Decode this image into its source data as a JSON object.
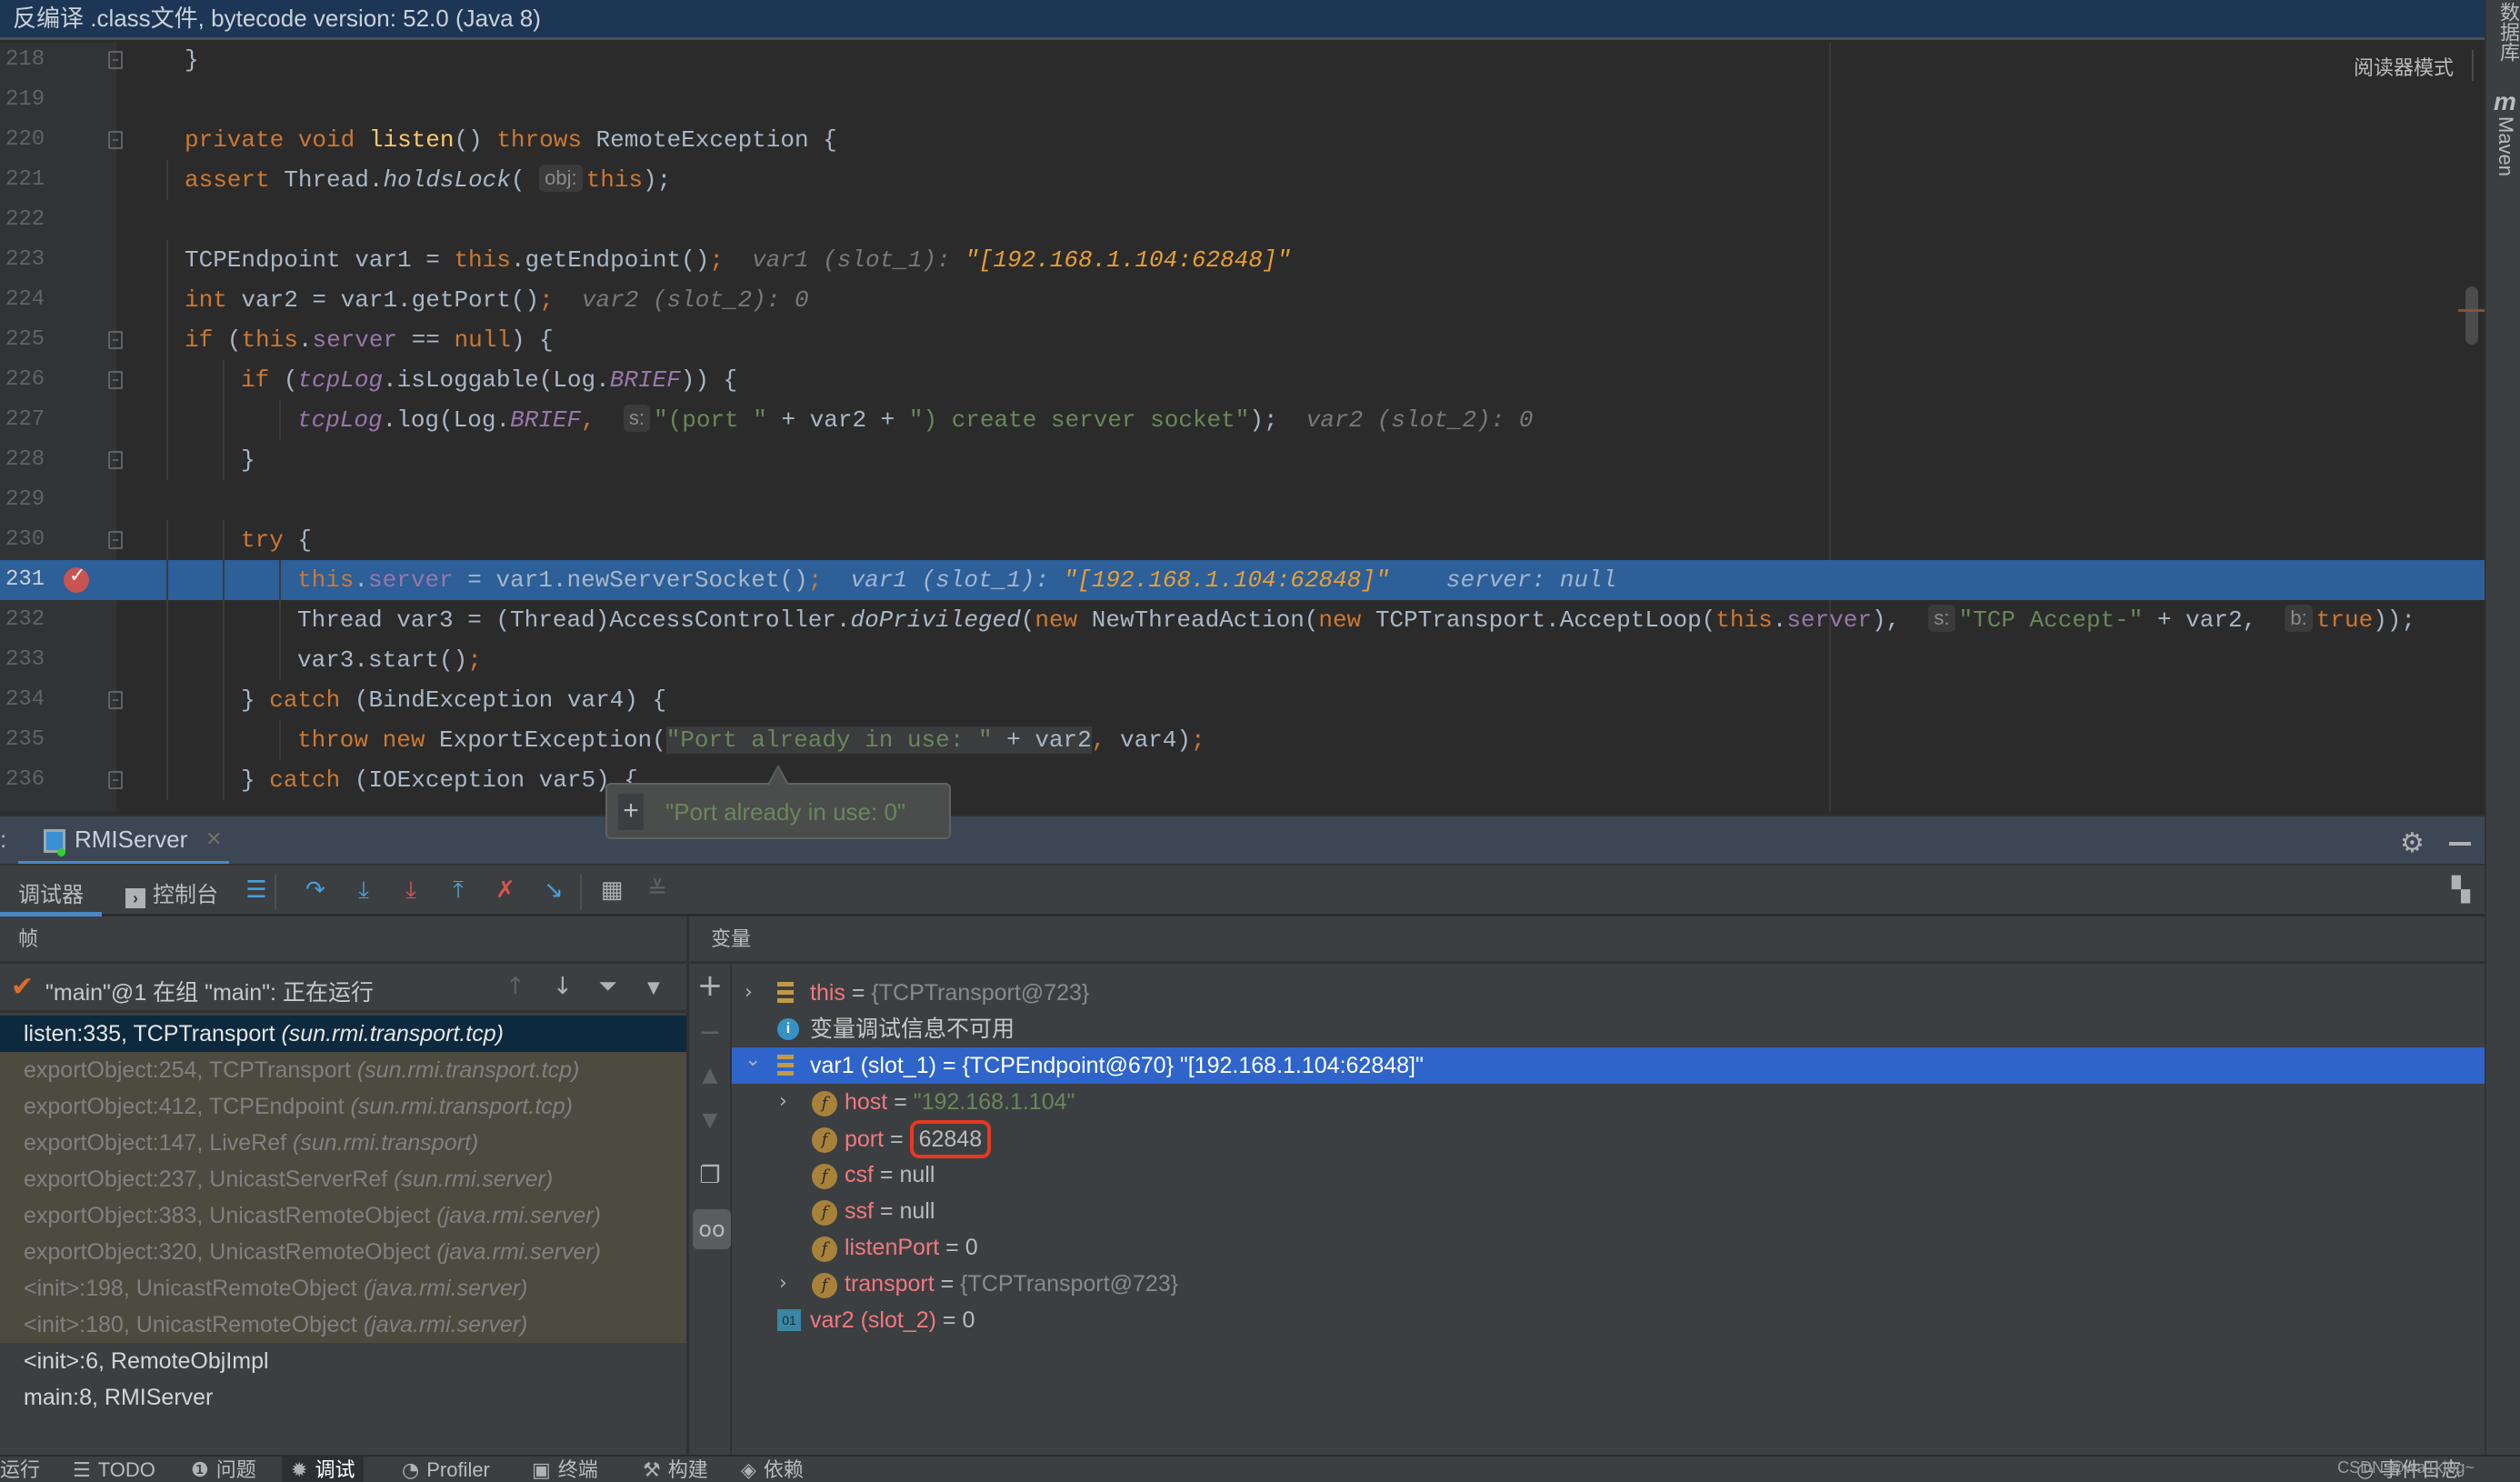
{
  "banner": {
    "text": "反编译 .class文件, bytecode version: 52.0 (Java 8)"
  },
  "editor": {
    "reader_mode": "阅读器模式",
    "current_line": 231,
    "breakpoint_line": 231,
    "lines": [
      {
        "n": "218",
        "code": "}"
      },
      {
        "n": "219",
        "code": ""
      },
      {
        "n": "220",
        "code": "private void listen() throws RemoteException {"
      },
      {
        "n": "221",
        "code": "assert Thread.holdsLock( obj: this);"
      },
      {
        "n": "222",
        "code": ""
      },
      {
        "n": "223",
        "code": "TCPEndpoint var1 = this.getEndpoint();",
        "hint_label": "var1 (slot_1): ",
        "hint_value": "\"[192.168.1.104:62848]\""
      },
      {
        "n": "224",
        "code": "int var2 = var1.getPort();",
        "hint_label": "var2 (slot_2): 0"
      },
      {
        "n": "225",
        "code": "if (this.server == null) {"
      },
      {
        "n": "226",
        "code": "if (tcpLog.isLoggable(Log.BRIEF)) {"
      },
      {
        "n": "227",
        "code": "tcpLog.log(Log.BRIEF,  s: \"(port \" + var2 + \") create server socket\");",
        "hint_label": "var2 (slot_2): 0"
      },
      {
        "n": "228",
        "code": "}"
      },
      {
        "n": "229",
        "code": ""
      },
      {
        "n": "230",
        "code": "try {"
      },
      {
        "n": "231",
        "code": "this.server = var1.newServerSocket();",
        "hint_label": "var1 (slot_1): ",
        "hint_value": "\"[192.168.1.104:62848]\"",
        "hint_extra": "server: null"
      },
      {
        "n": "232",
        "code": "Thread var3 = (Thread)AccessController.doPrivileged(new NewThreadAction(new TCPTransport.AcceptLoop(this.server),  s: \"TCP Accept-\" + var2,  b: true));"
      },
      {
        "n": "233",
        "code": "var3.start();"
      },
      {
        "n": "234",
        "code": "} catch (BindException var4) {"
      },
      {
        "n": "235",
        "code": "throw new ExportException(\"Port already in use: \" + var2, var4);"
      },
      {
        "n": "236",
        "code": "} catch (IOException var5) {"
      }
    ],
    "tokens": {
      "l220": [
        "private",
        "void",
        "listen",
        "()",
        "throws",
        "RemoteException {"
      ],
      "l221": [
        "assert",
        "Thread.",
        "holdsLock",
        "(",
        "obj:",
        "this",
        ");"
      ],
      "l223": [
        "TCPEndpoint var1 = ",
        "this",
        ".getEndpoint()",
        ";"
      ],
      "l224": [
        "int",
        " var2 = var1.getPort()",
        ";"
      ],
      "l225": [
        "if",
        " (",
        "this",
        ".",
        "server",
        " == ",
        "null",
        ") {"
      ],
      "l226": [
        "if",
        " (",
        "tcpLog",
        ".isLoggable(Log.",
        "BRIEF",
        ")) {"
      ],
      "l227": [
        "tcpLog",
        ".log(Log.",
        "BRIEF",
        ",",
        "s:",
        "\"(port \"",
        " + var2 + ",
        "\") create server socket\"",
        ");"
      ],
      "l230": [
        "try",
        " {"
      ],
      "l231": [
        "this",
        ".",
        "server",
        " = var1.newServerSocket()",
        ";"
      ],
      "l232": [
        "Thread var3 = (Thread)AccessController.",
        "doPrivileged",
        "(",
        "new",
        " NewThreadAction(",
        "new",
        " TCPTransport.AcceptLoop(",
        "this",
        ".",
        "server",
        "),",
        "s:",
        "\"TCP Accept-\"",
        " + var2,",
        "b:",
        "true",
        "));"
      ],
      "l233": [
        "var3.start()",
        ";"
      ],
      "l234": [
        "} ",
        "catch",
        " (BindException var4) {"
      ],
      "l235": [
        "throw",
        "new",
        " ExportException(",
        "\"Port already in use: \"",
        " + var2",
        ",",
        " var4)",
        ";"
      ],
      "l236": [
        "} ",
        "catch",
        " (IOException var5) {"
      ]
    },
    "tooltip": {
      "value": "\"Port already in use: 0\""
    }
  },
  "right_strip": {
    "database": "数据库",
    "maven": "Maven",
    "maven_icon": "m"
  },
  "debug": {
    "prefix": ":",
    "session_tab": "RMIServer",
    "tabs": {
      "debugger": "调试器",
      "console": "控制台"
    },
    "toolbar_icons": [
      "frames-layout-icon",
      "step-over-icon",
      "step-into-icon",
      "force-step-into-icon",
      "step-out-icon",
      "drop-frame-icon",
      "run-to-cursor-icon",
      "evaluate-expression-icon",
      "trace-stream-icon"
    ],
    "frames_header": "帧",
    "variables_header": "变量",
    "thread": "\"main\"@1 在组 \"main\": 正在运行",
    "frames": [
      {
        "method": "listen:335, TCPTransport ",
        "pkg": "(sun.rmi.transport.tcp)",
        "kind": "selected"
      },
      {
        "method": "exportObject:254, TCPTransport ",
        "pkg": "(sun.rmi.transport.tcp)",
        "kind": "lib"
      },
      {
        "method": "exportObject:412, TCPEndpoint ",
        "pkg": "(sun.rmi.transport.tcp)",
        "kind": "lib"
      },
      {
        "method": "exportObject:147, LiveRef ",
        "pkg": "(sun.rmi.transport)",
        "kind": "lib"
      },
      {
        "method": "exportObject:237, UnicastServerRef ",
        "pkg": "(sun.rmi.server)",
        "kind": "lib"
      },
      {
        "method": "exportObject:383, UnicastRemoteObject ",
        "pkg": "(java.rmi.server)",
        "kind": "lib"
      },
      {
        "method": "exportObject:320, UnicastRemoteObject ",
        "pkg": "(java.rmi.server)",
        "kind": "lib"
      },
      {
        "method": "<init>:198, UnicastRemoteObject ",
        "pkg": "(java.rmi.server)",
        "kind": "lib"
      },
      {
        "method": "<init>:180, UnicastRemoteObject ",
        "pkg": "(java.rmi.server)",
        "kind": "lib"
      },
      {
        "method": "<init>:6, RemoteObjImpl",
        "pkg": "",
        "kind": "user"
      },
      {
        "method": "main:8, RMIServer",
        "pkg": "",
        "kind": "user"
      }
    ],
    "variables": [
      {
        "name": "this",
        "eq": " = ",
        "value": "{TCPTransport@723}",
        "vtype": "obj",
        "icon": "object",
        "expand": "collapsed",
        "depth": 0
      },
      {
        "name": "",
        "eq": "",
        "value": "变量调试信息不可用",
        "vtype": "info",
        "icon": "info",
        "expand": "none",
        "depth": 0
      },
      {
        "name": "var1 (slot_1)",
        "eq": " = ",
        "value": "{TCPEndpoint@670} \"[192.168.1.104:62848]\"",
        "vtype": "obj",
        "icon": "object",
        "expand": "expanded",
        "depth": 0,
        "selected": true
      },
      {
        "name": "host",
        "eq": " = ",
        "value": "\"192.168.1.104\"",
        "vtype": "str",
        "icon": "field",
        "expand": "collapsed",
        "depth": 1
      },
      {
        "name": "port",
        "eq": " = ",
        "value": "62848",
        "vtype": "num",
        "icon": "field",
        "expand": "none",
        "depth": 1,
        "highlighted": true
      },
      {
        "name": "csf",
        "eq": " = ",
        "value": "null",
        "vtype": "num",
        "icon": "field",
        "expand": "none",
        "depth": 1
      },
      {
        "name": "ssf",
        "eq": " = ",
        "value": "null",
        "vtype": "num",
        "icon": "field",
        "expand": "none",
        "depth": 1
      },
      {
        "name": "listenPort",
        "eq": " = ",
        "value": "0",
        "vtype": "num",
        "icon": "field",
        "expand": "none",
        "depth": 1
      },
      {
        "name": "transport",
        "eq": " = ",
        "value": "{TCPTransport@723}",
        "vtype": "obj",
        "icon": "field",
        "expand": "collapsed",
        "depth": 1
      },
      {
        "name": "var2 (slot_2)",
        "eq": " = ",
        "value": "0",
        "vtype": "num",
        "icon": "primitive",
        "expand": "none",
        "depth": 0
      }
    ]
  },
  "statusbar": {
    "items": [
      {
        "label": "运行",
        "icon": ""
      },
      {
        "label": "TODO",
        "icon": "☰"
      },
      {
        "label": "问题",
        "icon": "❶"
      },
      {
        "label": "调试",
        "icon": "✹",
        "active": true
      },
      {
        "label": "Profiler",
        "icon": "◔"
      },
      {
        "label": "终端",
        "icon": "▣"
      },
      {
        "label": "构建",
        "icon": "⚒"
      },
      {
        "label": "依赖",
        "icon": "◈"
      }
    ],
    "event_log": "事件日志",
    "watermark": "CSDN @wa1ki0g~"
  }
}
